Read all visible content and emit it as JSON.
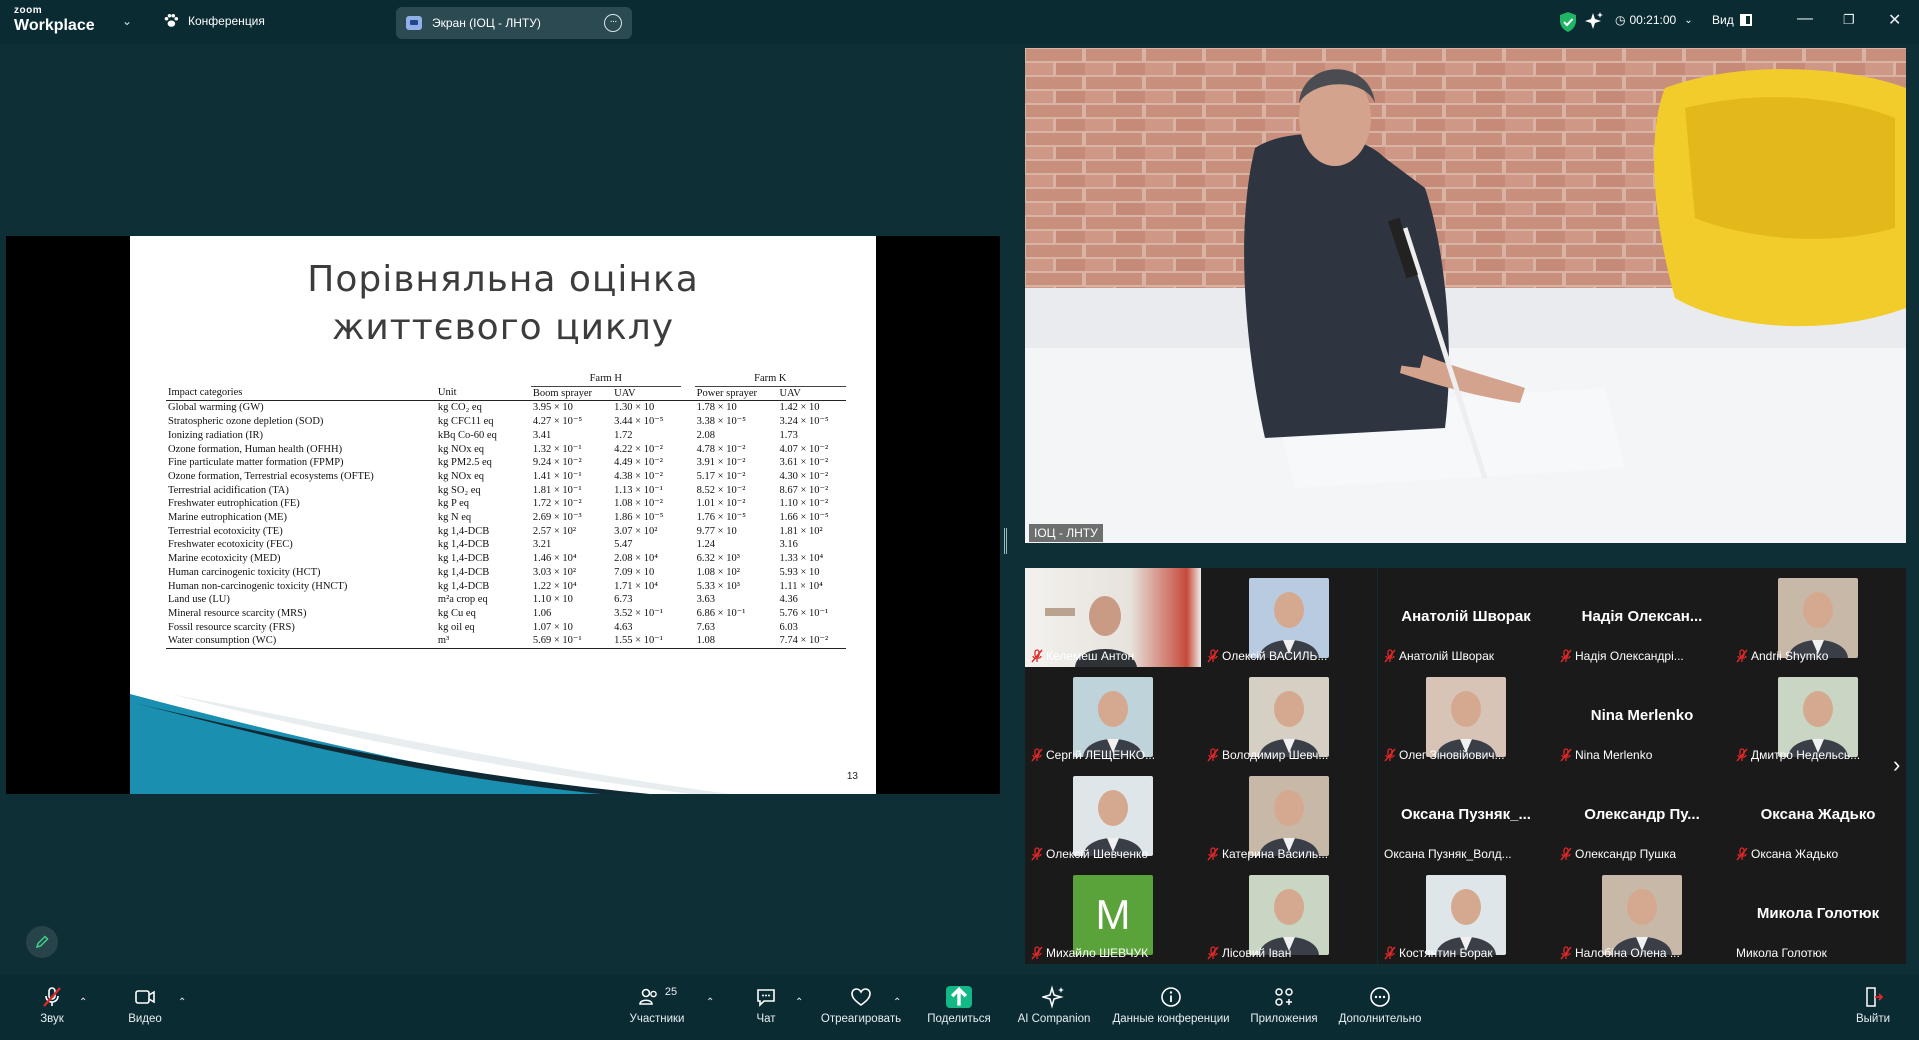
{
  "app": {
    "logo_top": "zoom",
    "logo_bottom": "Workplace"
  },
  "titlebar": {
    "meeting_button": "Конференция",
    "screen_tab": "Экран (ІОЦ - ЛНТУ)",
    "timer": "00:21:00",
    "view_button": "Вид"
  },
  "slide": {
    "title_line1": "Порівняльна оцінка",
    "title_line2": "життєвого циклу",
    "page": "13",
    "table": {
      "farm_h": "Farm H",
      "farm_k": "Farm K",
      "headers": [
        "Impact categories",
        "Unit",
        "Boom sprayer",
        "UAV",
        "Power sprayer",
        "UAV"
      ],
      "rows": [
        [
          "Global warming (GW)",
          "kg CO₂ eq",
          "3.95 × 10",
          "1.30 × 10",
          "1.78 × 10",
          "1.42 × 10"
        ],
        [
          "Stratospheric ozone depletion (SOD)",
          "kg CFC11 eq",
          "4.27 × 10⁻⁵",
          "3.44 × 10⁻⁵",
          "3.38 × 10⁻⁵",
          "3.24 × 10⁻⁵"
        ],
        [
          "Ionizing radiation (IR)",
          "kBq Co-60 eq",
          "3.41",
          "1.72",
          "2.08",
          "1.73"
        ],
        [
          "Ozone formation, Human health (OFHH)",
          "kg NOx eq",
          "1.32 × 10⁻¹",
          "4.22 × 10⁻²",
          "4.78 × 10⁻²",
          "4.07 × 10⁻²"
        ],
        [
          "Fine particulate matter formation (FPMP)",
          "kg PM2.5 eq",
          "9.24 × 10⁻²",
          "4.49 × 10⁻²",
          "3.91 × 10⁻²",
          "3.61 × 10⁻²"
        ],
        [
          "Ozone formation, Terrestrial ecosystems (OFTE)",
          "kg NOx eq",
          "1.41 × 10⁻¹",
          "4.38 × 10⁻²",
          "5.17 × 10⁻²",
          "4.30 × 10⁻²"
        ],
        [
          "Terrestrial acidification (TA)",
          "kg SO₂ eq",
          "1.81 × 10⁻¹",
          "1.13 × 10⁻¹",
          "8.52 × 10⁻²",
          "8.67 × 10⁻²"
        ],
        [
          "Freshwater eutrophication (FE)",
          "kg P eq",
          "1.72 × 10⁻²",
          "1.08 × 10⁻²",
          "1.01 × 10⁻²",
          "1.10 × 10⁻²"
        ],
        [
          "Marine eutrophication (ME)",
          "kg N eq",
          "2.69 × 10⁻³",
          "1.86 × 10⁻⁵",
          "1.76 × 10⁻⁵",
          "1.66 × 10⁻⁵"
        ],
        [
          "Terrestrial ecotoxicity (TE)",
          "kg 1,4-DCB",
          "2.57 × 10²",
          "3.07 × 10²",
          "9.77 × 10",
          "1.81 × 10²"
        ],
        [
          "Freshwater ecotoxicity (FEC)",
          "kg 1,4-DCB",
          "3.21",
          "5.47",
          "1.24",
          "3.16"
        ],
        [
          "Marine ecotoxicity (MED)",
          "kg 1,4-DCB",
          "1.46 × 10⁴",
          "2.08 × 10⁴",
          "6.32 × 10³",
          "1.33 × 10⁴"
        ],
        [
          "Human carcinogenic toxicity (HCT)",
          "kg 1,4-DCB",
          "3.03 × 10²",
          "7.09 × 10",
          "1.08 × 10²",
          "5.93 × 10"
        ],
        [
          "Human non-carcinogenic toxicity (HNCT)",
          "kg 1,4-DCB",
          "1.22 × 10⁴",
          "1.71 × 10⁴",
          "5.33 × 10³",
          "1.11 × 10⁴"
        ],
        [
          "Land use (LU)",
          "m²a crop eq",
          "1.10 × 10",
          "6.73",
          "3.63",
          "4.36"
        ],
        [
          "Mineral resource scarcity (MRS)",
          "kg Cu eq",
          "1.06",
          "3.52 × 10⁻¹",
          "6.86 × 10⁻¹",
          "5.76 × 10⁻¹"
        ],
        [
          "Fossil resource scarcity (FRS)",
          "kg oil eq",
          "1.07 × 10",
          "4.63",
          "7.63",
          "6.03"
        ],
        [
          "Water consumption (WC)",
          "m³",
          "5.69 × 10⁻¹",
          "1.55 × 10⁻¹",
          "1.08",
          "7.74 × 10⁻²"
        ]
      ]
    }
  },
  "speaker": {
    "label": "ІОЦ - ЛНТУ"
  },
  "gallery": {
    "tiles": [
      {
        "name": "Келемеш Антон",
        "type": "video"
      },
      {
        "name": "Олексій ВАСИЛЬ...",
        "type": "photo"
      },
      {
        "name": "Анатолій Шворак",
        "type": "name",
        "display": "Анатолій Шворак"
      },
      {
        "name": "Надія Олександрі...",
        "type": "name",
        "display": "Надія Олексан..."
      },
      {
        "name": "Andrii Shymko",
        "type": "photo"
      },
      {
        "name": "Сергій ЛЕЩЕНКО...",
        "type": "photo"
      },
      {
        "name": "Володимир Шевч...",
        "type": "photo"
      },
      {
        "name": "Олег Зіновійович...",
        "type": "photo"
      },
      {
        "name": "Nina Merlenko",
        "type": "name",
        "display": "Nina Merlenko"
      },
      {
        "name": "Дмитро Недельсь...",
        "type": "photo"
      },
      {
        "name": "Олексій Шевченко",
        "type": "photo"
      },
      {
        "name": "Катерина Василь...",
        "type": "photo"
      },
      {
        "name": "Оксана Пузняк_Волд...",
        "type": "name",
        "display": "Оксана Пузняк_...",
        "nomic": true
      },
      {
        "name": "Олександр Пушка",
        "type": "name",
        "display": "Олександр Пу..."
      },
      {
        "name": "Оксана Жадько",
        "type": "name",
        "display": "Оксана Жадько"
      },
      {
        "name": "Михайло ШЕВЧУК",
        "type": "letter",
        "letter": "M"
      },
      {
        "name": "Лісовий Іван",
        "type": "photo"
      },
      {
        "name": "Костянтин Борак",
        "type": "photo"
      },
      {
        "name": "Налобіна Олена ...",
        "type": "photo"
      },
      {
        "name": "Микола Голотюк",
        "type": "name",
        "display": "Микола Голотюк",
        "nomic": true
      }
    ]
  },
  "toolbar": {
    "audio": "Звук",
    "video": "Видео",
    "participants": "Участники",
    "participants_count": "25",
    "chat": "Чат",
    "react": "Отреагировать",
    "share": "Поделиться",
    "ai": "AI Companion",
    "info": "Данные конференции",
    "apps": "Приложения",
    "more": "Дополнительно",
    "leave": "Выйти"
  },
  "colors": {
    "background": "#0e2f36",
    "toolbar": "#0b2b33",
    "share_green": "#12b886",
    "mic_muted": "#e02828"
  }
}
